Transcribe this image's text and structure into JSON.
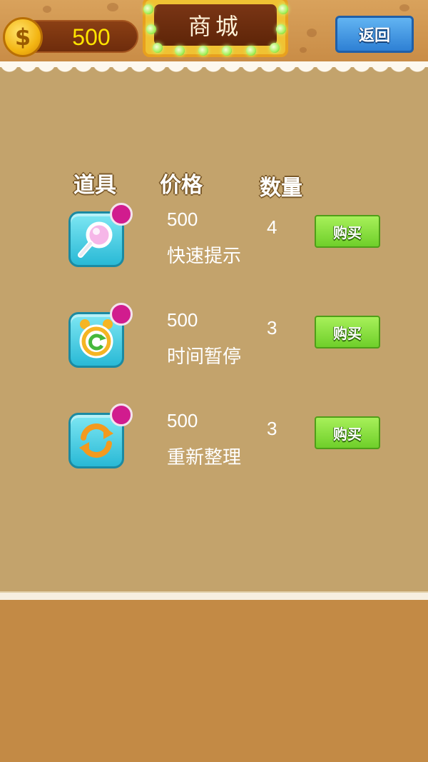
{
  "header": {
    "coins": "500",
    "title": "商城",
    "back_label": "返回"
  },
  "columns": {
    "item": "道具",
    "price": "价格",
    "quantity": "数量"
  },
  "items": [
    {
      "icon": "magnifier-icon",
      "price": "500",
      "name": "快速提示",
      "quantity": "4",
      "buy_label": "购买"
    },
    {
      "icon": "stopwatch-icon",
      "price": "500",
      "name": "时间暂停",
      "quantity": "3",
      "buy_label": "购买"
    },
    {
      "icon": "refresh-icon",
      "price": "500",
      "name": "重新整理",
      "quantity": "3",
      "buy_label": "购买"
    }
  ],
  "colors": {
    "background": "#c3a36c",
    "coin_text": "#ffe400",
    "buy_button": "#8fe246",
    "back_button": "#3f94e0",
    "badge": "#d11c8e",
    "icon_tile": "#4fd1e6"
  }
}
